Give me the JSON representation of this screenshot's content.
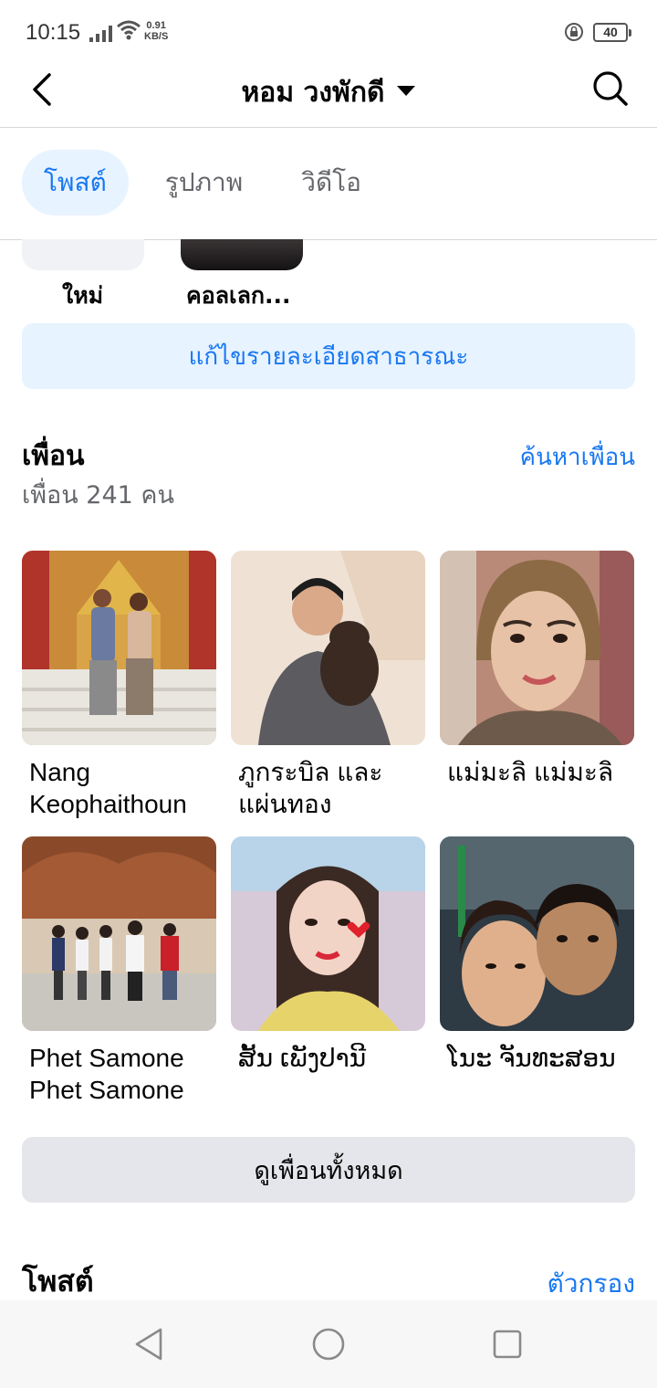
{
  "status_bar": {
    "time": "10:15",
    "speed_value": "0.91",
    "speed_unit": "KB/S",
    "battery": "40"
  },
  "header": {
    "title": "หอม วงพักดี",
    "back_icon": "chevron-left-icon",
    "search_icon": "search-icon"
  },
  "tabs": [
    {
      "label": "โพสต์",
      "active": true
    },
    {
      "label": "รูปภาพ",
      "active": false
    },
    {
      "label": "วิดีโอ",
      "active": false
    }
  ],
  "highlights": [
    {
      "label": "ใหม่"
    },
    {
      "label": "คอลเลก..."
    }
  ],
  "edit_details_label": "แก้ไขรายละเอียดสาธารณะ",
  "friends": {
    "title": "เพื่อน",
    "count_text": "เพื่อน 241 คน",
    "find_link": "ค้นหาเพื่อน",
    "items": [
      {
        "name": "Nang Keophaithoun"
      },
      {
        "name": "ภูกระบิล และ แผ่นทอง"
      },
      {
        "name": "แม่มะลิ แม่มะลิ"
      },
      {
        "name": "Phet Samone Phet Samone"
      },
      {
        "name": "ສັ້ນ ເພັງປານີ"
      },
      {
        "name": "ໂນະ ຈັນທະສອນ"
      }
    ],
    "see_all_label": "ดูเพื่อนทั้งหมด"
  },
  "posts": {
    "title": "โพสต์",
    "filter_link": "ตัวกรอง"
  },
  "nav_bar": {
    "back_icon": "triangle-back-icon",
    "home_icon": "circle-home-icon",
    "recents_icon": "square-recents-icon"
  },
  "colors": {
    "accent": "#1877f2",
    "accent_bg": "#e7f3ff",
    "secondary_text": "#65676b",
    "button_gray": "#e4e6eb"
  }
}
